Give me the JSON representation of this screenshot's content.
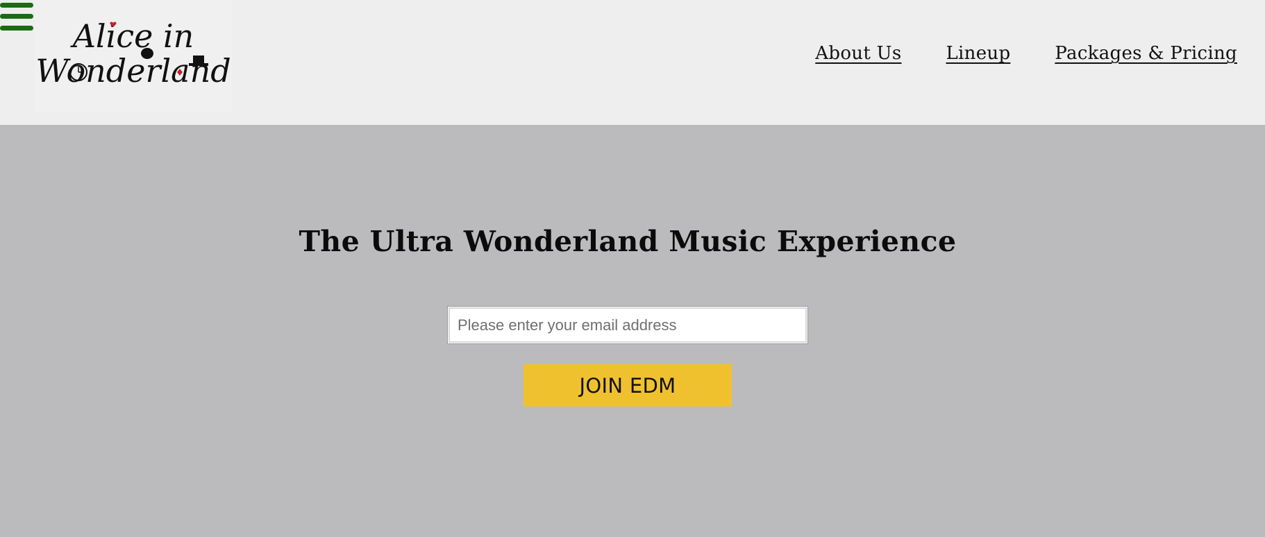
{
  "header": {
    "menu_icon": "hamburger-menu-icon",
    "logo": {
      "line1": "Alice in",
      "line2": "Wonderland"
    },
    "nav": [
      {
        "label": "About Us"
      },
      {
        "label": "Lineup"
      },
      {
        "label": "Packages & Pricing"
      }
    ]
  },
  "hero": {
    "title": "The Ultra Wonderland Music Experience",
    "email_placeholder": "Please enter your email address",
    "email_value": "",
    "join_label": "JOIN EDM"
  },
  "colors": {
    "header_bg": "#eeeeee",
    "page_bg": "#bbbbbd",
    "menu_icon": "#1a6b14",
    "button_bg": "#f0c12f"
  }
}
